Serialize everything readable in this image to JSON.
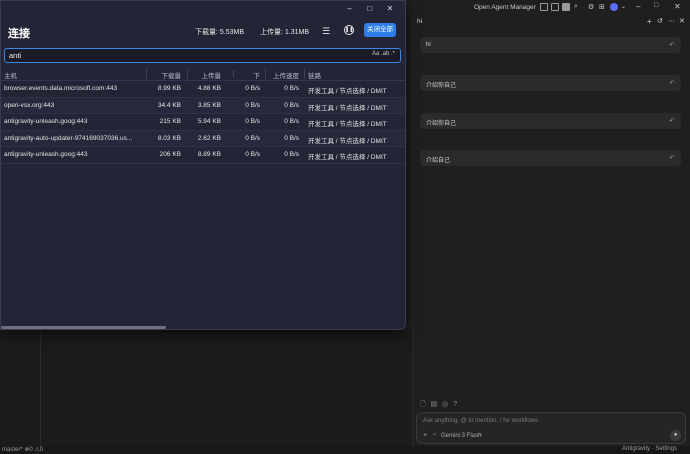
{
  "connections_window": {
    "title": "连接",
    "download_total_label": "下载量: 5.53MB",
    "upload_total_label": "上传量: 1.31MB",
    "close_all_label": "关闭全部",
    "search": {
      "value": "anti",
      "options": "Aa  .ab  .*"
    },
    "columns": {
      "host": "主机",
      "download": "下载量",
      "upload": "上传量",
      "download_speed": "下",
      "upload_speed": "上传速度",
      "rule": "链路"
    },
    "rows": [
      {
        "host": "browser.events.data.microsoft.com:443",
        "download": "8.99 KB",
        "upload": "4.88 KB",
        "download_speed": "0 B/s",
        "upload_speed": "0 B/s",
        "rule": "开发工具 / 节点选择 / DMIT"
      },
      {
        "host": "open-vsx.org:443",
        "download": "34.4 KB",
        "upload": "3.85 KB",
        "download_speed": "0 B/s",
        "upload_speed": "0 B/s",
        "rule": "开发工具 / 节点选择 / DMIT"
      },
      {
        "host": "antigravity-unleash.goog:443",
        "download": "215 KB",
        "upload": "5.94 KB",
        "download_speed": "0 B/s",
        "upload_speed": "0 B/s",
        "rule": "开发工具 / 节点选择 / DMIT"
      },
      {
        "host": "antigravity-auto-updater-974169037036.us...",
        "download": "8.03 KB",
        "upload": "2.62 KB",
        "download_speed": "0 B/s",
        "upload_speed": "0 B/s",
        "rule": "开发工具 / 节点选择 / DMIT"
      },
      {
        "host": "antigravity-unleash.goog:443",
        "download": "206 KB",
        "upload": "8.89 KB",
        "download_speed": "0 B/s",
        "upload_speed": "0 B/s",
        "rule": "开发工具 / 节点选择 / DMIT"
      }
    ]
  },
  "agent_panel": {
    "window_title": "Open Agent Manager",
    "chat_title": "hi",
    "messages": [
      "hi",
      "介绍你自己",
      "介绍你自己",
      "介绍自己"
    ],
    "input_placeholder": "Ask anything, @ to mention, / for workflows",
    "model_label": "Gemini 3 Flash"
  },
  "status_bar": {
    "left": "master* ⊗0 ⚠0",
    "right": "Antigravity · Settings"
  },
  "colors": {
    "accent": "#2f7fe8",
    "window_bg": "#232436",
    "panel_bg": "#1f1f1f"
  }
}
